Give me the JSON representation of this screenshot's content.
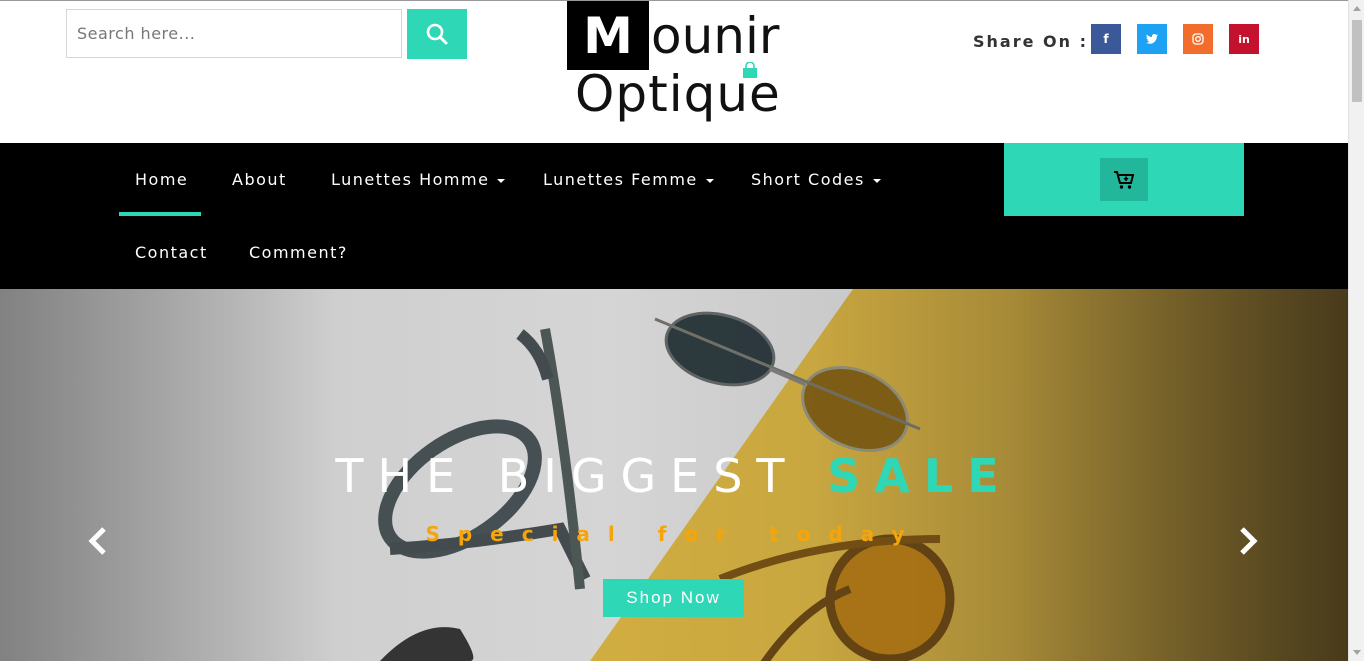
{
  "header": {
    "search": {
      "placeholder": "Search here..."
    },
    "logo": {
      "letter": "M",
      "line1_rest": "ounir",
      "line2": "Optique"
    },
    "share": {
      "label": "Share On :",
      "icons": [
        {
          "name": "facebook-icon",
          "glyph": "f",
          "color": "#3b5998"
        },
        {
          "name": "twitter-icon",
          "glyph": "t",
          "color": "#1da1f2"
        },
        {
          "name": "instagram-icon",
          "glyph": "◎",
          "color": "#f26d2c"
        },
        {
          "name": "linkedin-icon",
          "glyph": "in",
          "color": "#c4122e"
        }
      ]
    }
  },
  "nav": {
    "items": [
      {
        "label": "Home",
        "active": true
      },
      {
        "label": "About"
      },
      {
        "label": "Lunettes Homme",
        "dropdown": true
      },
      {
        "label": "Lunettes Femme",
        "dropdown": true
      },
      {
        "label": "Short Codes",
        "dropdown": true
      },
      {
        "label": "Contact"
      },
      {
        "label": "Comment?"
      }
    ]
  },
  "hero": {
    "title_main": "THE BIGGEST ",
    "title_accent": "SALE",
    "subtitle": "Special for today",
    "cta": "Shop Now"
  },
  "colors": {
    "accent": "#2ed8b6",
    "nav_bg": "#000000",
    "subtitle": "#f5a50a"
  }
}
